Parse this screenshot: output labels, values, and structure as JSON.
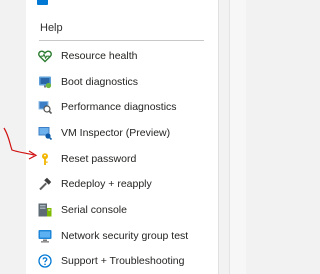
{
  "help_menu": {
    "header": "Help",
    "items": [
      {
        "label": "Resource health",
        "icon": "heart-icon"
      },
      {
        "label": "Boot diagnostics",
        "icon": "boot-diagnostics-icon"
      },
      {
        "label": "Performance diagnostics",
        "icon": "performance-diagnostics-icon"
      },
      {
        "label": "VM Inspector (Preview)",
        "icon": "vm-inspector-icon"
      },
      {
        "label": "Reset password",
        "icon": "key-icon"
      },
      {
        "label": "Redeploy + reapply",
        "icon": "hammer-icon"
      },
      {
        "label": "Serial console",
        "icon": "serial-console-icon"
      },
      {
        "label": "Network security group test",
        "icon": "network-security-icon"
      },
      {
        "label": "Support + Troubleshooting",
        "icon": "question-icon"
      }
    ]
  },
  "colors": {
    "heart": "#2e7d32",
    "key": "#f2b500",
    "info_blue": "#0078d4",
    "annotation_arrow": "#d01010"
  }
}
